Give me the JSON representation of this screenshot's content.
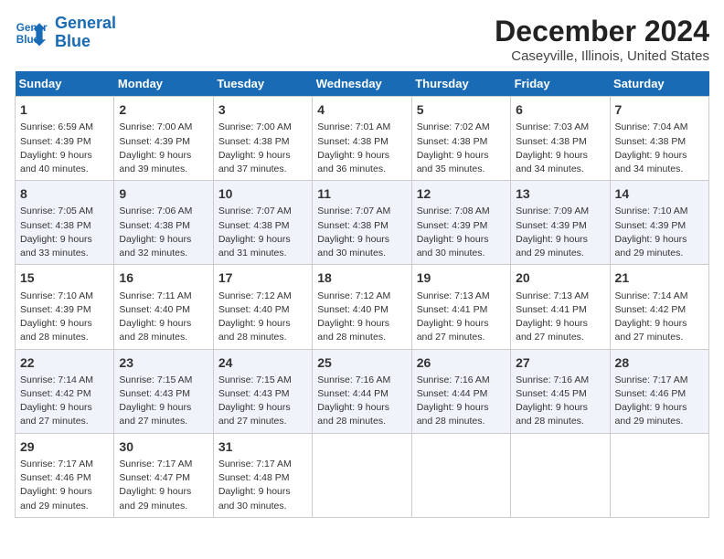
{
  "logo": {
    "line1": "General",
    "line2": "Blue"
  },
  "title": "December 2024",
  "subtitle": "Caseyville, Illinois, United States",
  "days_of_week": [
    "Sunday",
    "Monday",
    "Tuesday",
    "Wednesday",
    "Thursday",
    "Friday",
    "Saturday"
  ],
  "weeks": [
    [
      {
        "day": "1",
        "info": "Sunrise: 6:59 AM\nSunset: 4:39 PM\nDaylight: 9 hours\nand 40 minutes."
      },
      {
        "day": "2",
        "info": "Sunrise: 7:00 AM\nSunset: 4:39 PM\nDaylight: 9 hours\nand 39 minutes."
      },
      {
        "day": "3",
        "info": "Sunrise: 7:00 AM\nSunset: 4:38 PM\nDaylight: 9 hours\nand 37 minutes."
      },
      {
        "day": "4",
        "info": "Sunrise: 7:01 AM\nSunset: 4:38 PM\nDaylight: 9 hours\nand 36 minutes."
      },
      {
        "day": "5",
        "info": "Sunrise: 7:02 AM\nSunset: 4:38 PM\nDaylight: 9 hours\nand 35 minutes."
      },
      {
        "day": "6",
        "info": "Sunrise: 7:03 AM\nSunset: 4:38 PM\nDaylight: 9 hours\nand 34 minutes."
      },
      {
        "day": "7",
        "info": "Sunrise: 7:04 AM\nSunset: 4:38 PM\nDaylight: 9 hours\nand 34 minutes."
      }
    ],
    [
      {
        "day": "8",
        "info": "Sunrise: 7:05 AM\nSunset: 4:38 PM\nDaylight: 9 hours\nand 33 minutes."
      },
      {
        "day": "9",
        "info": "Sunrise: 7:06 AM\nSunset: 4:38 PM\nDaylight: 9 hours\nand 32 minutes."
      },
      {
        "day": "10",
        "info": "Sunrise: 7:07 AM\nSunset: 4:38 PM\nDaylight: 9 hours\nand 31 minutes."
      },
      {
        "day": "11",
        "info": "Sunrise: 7:07 AM\nSunset: 4:38 PM\nDaylight: 9 hours\nand 30 minutes."
      },
      {
        "day": "12",
        "info": "Sunrise: 7:08 AM\nSunset: 4:39 PM\nDaylight: 9 hours\nand 30 minutes."
      },
      {
        "day": "13",
        "info": "Sunrise: 7:09 AM\nSunset: 4:39 PM\nDaylight: 9 hours\nand 29 minutes."
      },
      {
        "day": "14",
        "info": "Sunrise: 7:10 AM\nSunset: 4:39 PM\nDaylight: 9 hours\nand 29 minutes."
      }
    ],
    [
      {
        "day": "15",
        "info": "Sunrise: 7:10 AM\nSunset: 4:39 PM\nDaylight: 9 hours\nand 28 minutes."
      },
      {
        "day": "16",
        "info": "Sunrise: 7:11 AM\nSunset: 4:40 PM\nDaylight: 9 hours\nand 28 minutes."
      },
      {
        "day": "17",
        "info": "Sunrise: 7:12 AM\nSunset: 4:40 PM\nDaylight: 9 hours\nand 28 minutes."
      },
      {
        "day": "18",
        "info": "Sunrise: 7:12 AM\nSunset: 4:40 PM\nDaylight: 9 hours\nand 28 minutes."
      },
      {
        "day": "19",
        "info": "Sunrise: 7:13 AM\nSunset: 4:41 PM\nDaylight: 9 hours\nand 27 minutes."
      },
      {
        "day": "20",
        "info": "Sunrise: 7:13 AM\nSunset: 4:41 PM\nDaylight: 9 hours\nand 27 minutes."
      },
      {
        "day": "21",
        "info": "Sunrise: 7:14 AM\nSunset: 4:42 PM\nDaylight: 9 hours\nand 27 minutes."
      }
    ],
    [
      {
        "day": "22",
        "info": "Sunrise: 7:14 AM\nSunset: 4:42 PM\nDaylight: 9 hours\nand 27 minutes."
      },
      {
        "day": "23",
        "info": "Sunrise: 7:15 AM\nSunset: 4:43 PM\nDaylight: 9 hours\nand 27 minutes."
      },
      {
        "day": "24",
        "info": "Sunrise: 7:15 AM\nSunset: 4:43 PM\nDaylight: 9 hours\nand 27 minutes."
      },
      {
        "day": "25",
        "info": "Sunrise: 7:16 AM\nSunset: 4:44 PM\nDaylight: 9 hours\nand 28 minutes."
      },
      {
        "day": "26",
        "info": "Sunrise: 7:16 AM\nSunset: 4:44 PM\nDaylight: 9 hours\nand 28 minutes."
      },
      {
        "day": "27",
        "info": "Sunrise: 7:16 AM\nSunset: 4:45 PM\nDaylight: 9 hours\nand 28 minutes."
      },
      {
        "day": "28",
        "info": "Sunrise: 7:17 AM\nSunset: 4:46 PM\nDaylight: 9 hours\nand 29 minutes."
      }
    ],
    [
      {
        "day": "29",
        "info": "Sunrise: 7:17 AM\nSunset: 4:46 PM\nDaylight: 9 hours\nand 29 minutes."
      },
      {
        "day": "30",
        "info": "Sunrise: 7:17 AM\nSunset: 4:47 PM\nDaylight: 9 hours\nand 29 minutes."
      },
      {
        "day": "31",
        "info": "Sunrise: 7:17 AM\nSunset: 4:48 PM\nDaylight: 9 hours\nand 30 minutes."
      },
      {
        "day": "",
        "info": ""
      },
      {
        "day": "",
        "info": ""
      },
      {
        "day": "",
        "info": ""
      },
      {
        "day": "",
        "info": ""
      }
    ]
  ]
}
